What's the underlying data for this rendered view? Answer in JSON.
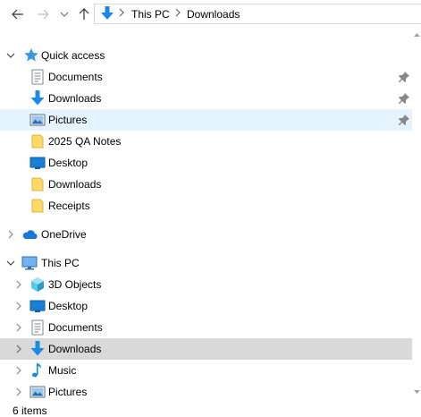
{
  "address": {
    "crumbs": [
      "This PC",
      "Downloads"
    ]
  },
  "tree": {
    "quick_access": {
      "label": "Quick access",
      "items": [
        {
          "label": "Documents",
          "pinned": true
        },
        {
          "label": "Downloads",
          "pinned": true
        },
        {
          "label": "Pictures",
          "pinned": true
        },
        {
          "label": "2025 QA Notes"
        },
        {
          "label": "Desktop"
        },
        {
          "label": "Downloads"
        },
        {
          "label": "Receipts"
        }
      ]
    },
    "onedrive": {
      "label": "OneDrive"
    },
    "this_pc": {
      "label": "This PC",
      "items": [
        {
          "label": "3D Objects"
        },
        {
          "label": "Desktop"
        },
        {
          "label": "Documents"
        },
        {
          "label": "Downloads"
        },
        {
          "label": "Music"
        },
        {
          "label": "Pictures"
        }
      ]
    }
  },
  "status": {
    "item_count": "6 items"
  },
  "colors": {
    "accent": "#0078d7",
    "selected": "#d9d9d9",
    "hover": "#e5f3ff",
    "folder": "#ffd866"
  }
}
